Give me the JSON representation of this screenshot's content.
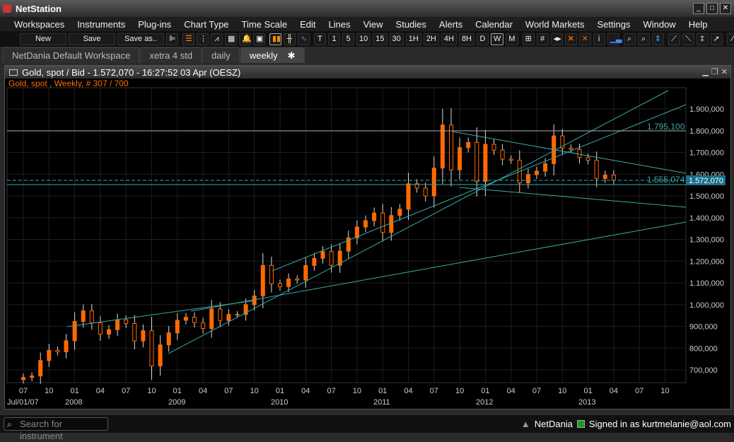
{
  "app": {
    "title": "NetStation"
  },
  "menu": [
    "Workspaces",
    "Instruments",
    "Plug-ins",
    "Chart Type",
    "Time Scale",
    "Edit",
    "Lines",
    "View",
    "Studies",
    "Alerts",
    "Calendar",
    "World Markets",
    "Settings",
    "Window",
    "Help"
  ],
  "toolbar": {
    "new": "New",
    "save": "Save",
    "save_as": "Save as..",
    "timescales": [
      "T",
      "1",
      "5",
      "10",
      "15",
      "30",
      "1H",
      "2H",
      "4H",
      "8H",
      "D",
      "W",
      "M"
    ],
    "selected": "W",
    "more": "»"
  },
  "tabs": [
    {
      "label": "NetDania Default Workspace"
    },
    {
      "label": "xetra 4 std"
    },
    {
      "label": "daily"
    },
    {
      "label": "weekly",
      "close": "✱"
    }
  ],
  "chart_window": {
    "title": "Gold, spot / Bid - 1.572,070 - 16:27:52  03 Apr (OESZ)",
    "subtitle": "Gold, spot , Weekly, # 307 / 700"
  },
  "chart_data": {
    "type": "candlestick",
    "period": "monthly approximation of weekly bars",
    "start": "Jul 2007",
    "closes": [
      665,
      672,
      743,
      790,
      783,
      834,
      923,
      971,
      916,
      864,
      885,
      930,
      913,
      833,
      880,
      718,
      815,
      870,
      928,
      942,
      917,
      890,
      980,
      927,
      955,
      955,
      1000,
      1040,
      1180,
      1096,
      1083,
      1118,
      1113,
      1180,
      1213,
      1244,
      1181,
      1246,
      1307,
      1357,
      1386,
      1421,
      1332,
      1410,
      1439,
      1556,
      1536,
      1500,
      1628,
      1826,
      1620,
      1722,
      1746,
      1566,
      1737,
      1711,
      1669,
      1664,
      1560,
      1598,
      1614,
      1648,
      1776,
      1720,
      1714,
      1676,
      1664,
      1580,
      1596,
      1572
    ],
    "price_unit": "thousands",
    "yticks": [
      "1.900,000",
      "1.800,000",
      "1.700,000",
      "1.600,000",
      "1.500,000",
      "1.400,000",
      "1.300,000",
      "1.200,000",
      "1.100,000",
      "1.000,000",
      "900,000",
      "800,000",
      "700,000"
    ],
    "ylim": [
      700000,
      1900000
    ],
    "xticks": [
      "07",
      "10",
      "01",
      "04",
      "07",
      "10",
      "01",
      "04",
      "07",
      "10",
      "01",
      "04",
      "07",
      "10",
      "01",
      "04",
      "07",
      "10",
      "01",
      "04",
      "07",
      "10",
      "01",
      "04",
      "07",
      "10"
    ],
    "year_labels": [
      "Jul/01/07",
      "2008",
      "2009",
      "2010",
      "2011",
      "2012",
      "2013"
    ],
    "levels": {
      "resistance": "1.795,100",
      "support": "1.555,074",
      "current": "1.572,070"
    },
    "colors": {
      "candle": "#ff6a00",
      "trend": "#3aa8a8",
      "grid": "#1e1e1e",
      "current": "#1a6f8a"
    }
  },
  "status": {
    "search_placeholder": "Search for instrument",
    "brand": "NetDania",
    "signed_in": "Signed in as kurtmelanie@aol.com"
  }
}
